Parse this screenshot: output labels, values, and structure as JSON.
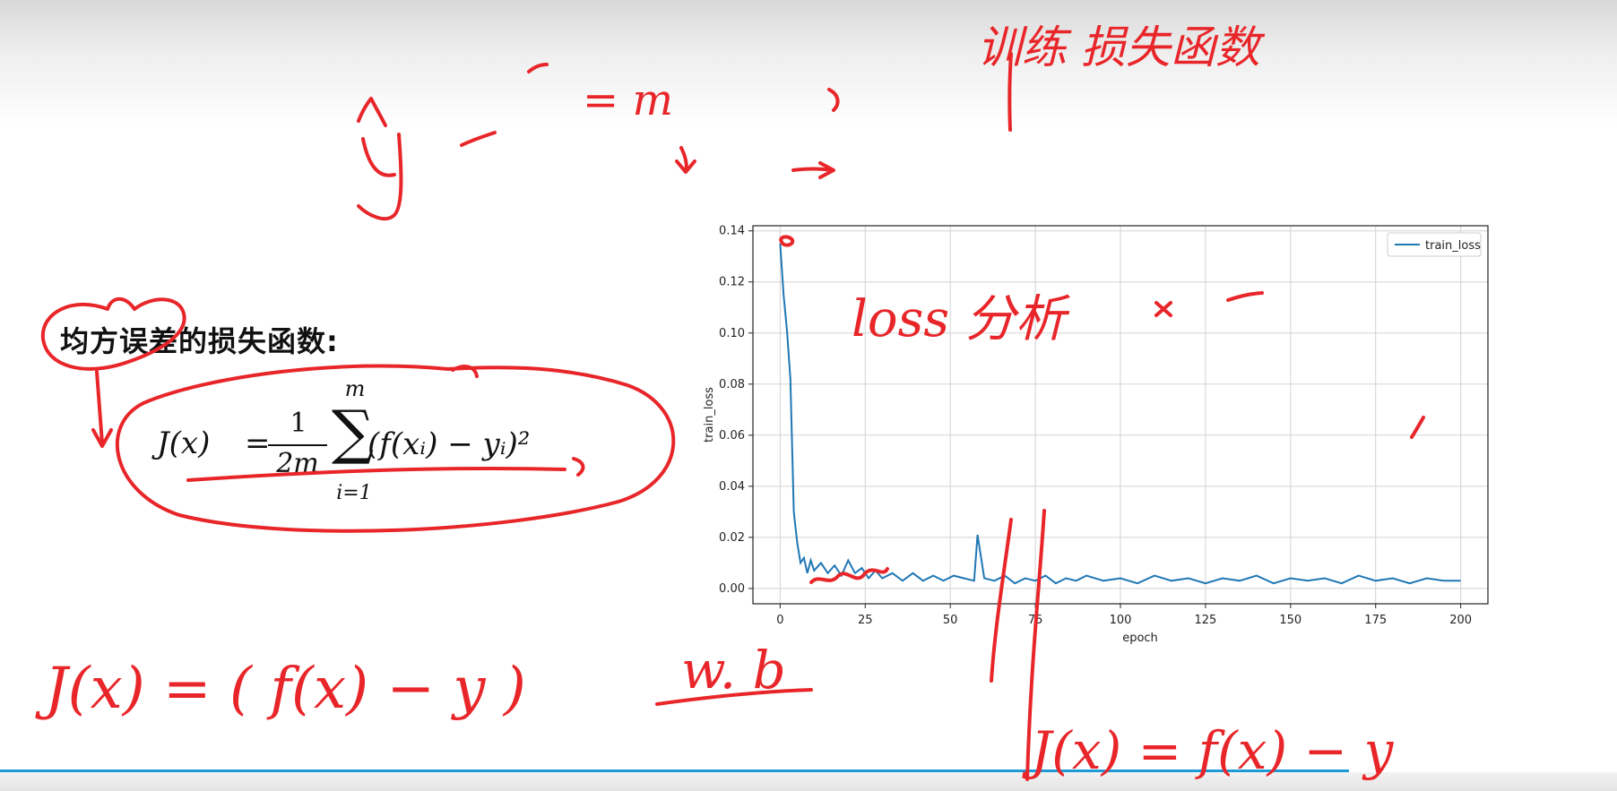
{
  "slide": {
    "heading": "均方误差的损失函数:",
    "formula": {
      "lhs": "J(x)",
      "equals": "=",
      "frac_numerator": "1",
      "frac_denominator": "2m",
      "sum_top": "m",
      "sum_bottom": "i=1",
      "sum_symbol": "∑",
      "body": "(f(xᵢ) − yᵢ)²"
    }
  },
  "annotations": {
    "top_right": "训练  损失函数",
    "loss_note": "loss 分析",
    "wb": "w. b",
    "eq_left": "J(x) = ( f(x) − y )",
    "eq_right": "J(x) = f(x) − y",
    "m_note": "= m",
    "ink_color": "#e8262a"
  },
  "chart_data": {
    "type": "line",
    "title": "",
    "xlabel": "epoch",
    "ylabel": "train_loss",
    "xlim": [
      -8,
      208
    ],
    "ylim": [
      -0.006,
      0.142
    ],
    "xticks": [
      0,
      25,
      50,
      75,
      100,
      125,
      150,
      175,
      200
    ],
    "yticks": [
      0.0,
      0.02,
      0.04,
      0.06,
      0.08,
      0.1,
      0.12,
      0.14
    ],
    "ytick_labels": [
      "0.00",
      "0.02",
      "0.04",
      "0.06",
      "0.08",
      "0.10",
      "0.12",
      "0.14"
    ],
    "grid": true,
    "legend": "top-right",
    "line_color": "#1f77b4",
    "series": [
      {
        "name": "train_loss",
        "x": [
          0,
          1,
          2,
          3,
          4,
          5,
          6,
          7,
          8,
          9,
          10,
          12,
          14,
          16,
          18,
          20,
          22,
          24,
          26,
          28,
          30,
          33,
          36,
          39,
          42,
          45,
          48,
          51,
          54,
          57,
          58,
          60,
          63,
          66,
          69,
          72,
          75,
          78,
          81,
          84,
          87,
          90,
          95,
          100,
          105,
          110,
          115,
          120,
          125,
          130,
          135,
          140,
          145,
          150,
          155,
          160,
          165,
          170,
          175,
          180,
          185,
          190,
          195,
          200
        ],
        "values": [
          0.135,
          0.115,
          0.101,
          0.082,
          0.03,
          0.018,
          0.01,
          0.012,
          0.006,
          0.011,
          0.007,
          0.01,
          0.006,
          0.009,
          0.005,
          0.011,
          0.006,
          0.008,
          0.004,
          0.007,
          0.004,
          0.006,
          0.003,
          0.006,
          0.003,
          0.005,
          0.003,
          0.005,
          0.004,
          0.003,
          0.021,
          0.004,
          0.003,
          0.005,
          0.002,
          0.004,
          0.003,
          0.005,
          0.002,
          0.004,
          0.003,
          0.005,
          0.003,
          0.004,
          0.002,
          0.005,
          0.003,
          0.004,
          0.002,
          0.004,
          0.003,
          0.005,
          0.002,
          0.004,
          0.003,
          0.004,
          0.002,
          0.005,
          0.003,
          0.004,
          0.002,
          0.004,
          0.003,
          0.003
        ]
      }
    ]
  }
}
